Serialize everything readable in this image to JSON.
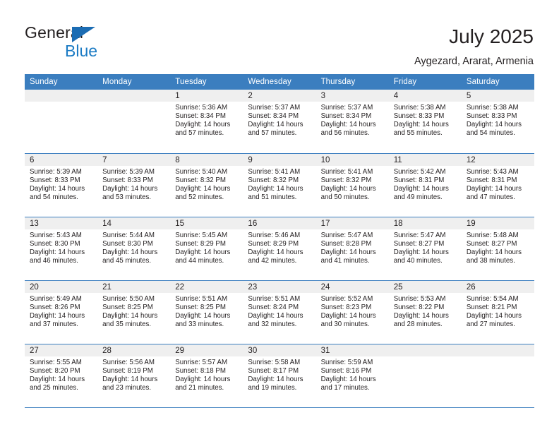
{
  "brand": {
    "name_dark": "General",
    "name_blue": "Blue",
    "triangle_icon": "triangle-icon",
    "accent_blue": "#1b7bc4",
    "header_blue": "#3b7ebf"
  },
  "header": {
    "title": "July 2025",
    "subtitle": "Aygezard, Ararat, Armenia"
  },
  "calendar": {
    "weekday_headers": [
      "Sunday",
      "Monday",
      "Tuesday",
      "Wednesday",
      "Thursday",
      "Friday",
      "Saturday"
    ],
    "labels": {
      "sunrise": "Sunrise:",
      "sunset": "Sunset:",
      "daylight": "Daylight:"
    },
    "weeks": [
      [
        {
          "day": "",
          "sunrise": "",
          "sunset": "",
          "daylight_line1": "",
          "daylight_line2": ""
        },
        {
          "day": "",
          "sunrise": "",
          "sunset": "",
          "daylight_line1": "",
          "daylight_line2": ""
        },
        {
          "day": "1",
          "sunrise": "Sunrise: 5:36 AM",
          "sunset": "Sunset: 8:34 PM",
          "daylight_line1": "Daylight: 14 hours",
          "daylight_line2": "and 57 minutes."
        },
        {
          "day": "2",
          "sunrise": "Sunrise: 5:37 AM",
          "sunset": "Sunset: 8:34 PM",
          "daylight_line1": "Daylight: 14 hours",
          "daylight_line2": "and 57 minutes."
        },
        {
          "day": "3",
          "sunrise": "Sunrise: 5:37 AM",
          "sunset": "Sunset: 8:34 PM",
          "daylight_line1": "Daylight: 14 hours",
          "daylight_line2": "and 56 minutes."
        },
        {
          "day": "4",
          "sunrise": "Sunrise: 5:38 AM",
          "sunset": "Sunset: 8:33 PM",
          "daylight_line1": "Daylight: 14 hours",
          "daylight_line2": "and 55 minutes."
        },
        {
          "day": "5",
          "sunrise": "Sunrise: 5:38 AM",
          "sunset": "Sunset: 8:33 PM",
          "daylight_line1": "Daylight: 14 hours",
          "daylight_line2": "and 54 minutes."
        }
      ],
      [
        {
          "day": "6",
          "sunrise": "Sunrise: 5:39 AM",
          "sunset": "Sunset: 8:33 PM",
          "daylight_line1": "Daylight: 14 hours",
          "daylight_line2": "and 54 minutes."
        },
        {
          "day": "7",
          "sunrise": "Sunrise: 5:39 AM",
          "sunset": "Sunset: 8:33 PM",
          "daylight_line1": "Daylight: 14 hours",
          "daylight_line2": "and 53 minutes."
        },
        {
          "day": "8",
          "sunrise": "Sunrise: 5:40 AM",
          "sunset": "Sunset: 8:32 PM",
          "daylight_line1": "Daylight: 14 hours",
          "daylight_line2": "and 52 minutes."
        },
        {
          "day": "9",
          "sunrise": "Sunrise: 5:41 AM",
          "sunset": "Sunset: 8:32 PM",
          "daylight_line1": "Daylight: 14 hours",
          "daylight_line2": "and 51 minutes."
        },
        {
          "day": "10",
          "sunrise": "Sunrise: 5:41 AM",
          "sunset": "Sunset: 8:32 PM",
          "daylight_line1": "Daylight: 14 hours",
          "daylight_line2": "and 50 minutes."
        },
        {
          "day": "11",
          "sunrise": "Sunrise: 5:42 AM",
          "sunset": "Sunset: 8:31 PM",
          "daylight_line1": "Daylight: 14 hours",
          "daylight_line2": "and 49 minutes."
        },
        {
          "day": "12",
          "sunrise": "Sunrise: 5:43 AM",
          "sunset": "Sunset: 8:31 PM",
          "daylight_line1": "Daylight: 14 hours",
          "daylight_line2": "and 47 minutes."
        }
      ],
      [
        {
          "day": "13",
          "sunrise": "Sunrise: 5:43 AM",
          "sunset": "Sunset: 8:30 PM",
          "daylight_line1": "Daylight: 14 hours",
          "daylight_line2": "and 46 minutes."
        },
        {
          "day": "14",
          "sunrise": "Sunrise: 5:44 AM",
          "sunset": "Sunset: 8:30 PM",
          "daylight_line1": "Daylight: 14 hours",
          "daylight_line2": "and 45 minutes."
        },
        {
          "day": "15",
          "sunrise": "Sunrise: 5:45 AM",
          "sunset": "Sunset: 8:29 PM",
          "daylight_line1": "Daylight: 14 hours",
          "daylight_line2": "and 44 minutes."
        },
        {
          "day": "16",
          "sunrise": "Sunrise: 5:46 AM",
          "sunset": "Sunset: 8:29 PM",
          "daylight_line1": "Daylight: 14 hours",
          "daylight_line2": "and 42 minutes."
        },
        {
          "day": "17",
          "sunrise": "Sunrise: 5:47 AM",
          "sunset": "Sunset: 8:28 PM",
          "daylight_line1": "Daylight: 14 hours",
          "daylight_line2": "and 41 minutes."
        },
        {
          "day": "18",
          "sunrise": "Sunrise: 5:47 AM",
          "sunset": "Sunset: 8:27 PM",
          "daylight_line1": "Daylight: 14 hours",
          "daylight_line2": "and 40 minutes."
        },
        {
          "day": "19",
          "sunrise": "Sunrise: 5:48 AM",
          "sunset": "Sunset: 8:27 PM",
          "daylight_line1": "Daylight: 14 hours",
          "daylight_line2": "and 38 minutes."
        }
      ],
      [
        {
          "day": "20",
          "sunrise": "Sunrise: 5:49 AM",
          "sunset": "Sunset: 8:26 PM",
          "daylight_line1": "Daylight: 14 hours",
          "daylight_line2": "and 37 minutes."
        },
        {
          "day": "21",
          "sunrise": "Sunrise: 5:50 AM",
          "sunset": "Sunset: 8:25 PM",
          "daylight_line1": "Daylight: 14 hours",
          "daylight_line2": "and 35 minutes."
        },
        {
          "day": "22",
          "sunrise": "Sunrise: 5:51 AM",
          "sunset": "Sunset: 8:25 PM",
          "daylight_line1": "Daylight: 14 hours",
          "daylight_line2": "and 33 minutes."
        },
        {
          "day": "23",
          "sunrise": "Sunrise: 5:51 AM",
          "sunset": "Sunset: 8:24 PM",
          "daylight_line1": "Daylight: 14 hours",
          "daylight_line2": "and 32 minutes."
        },
        {
          "day": "24",
          "sunrise": "Sunrise: 5:52 AM",
          "sunset": "Sunset: 8:23 PM",
          "daylight_line1": "Daylight: 14 hours",
          "daylight_line2": "and 30 minutes."
        },
        {
          "day": "25",
          "sunrise": "Sunrise: 5:53 AM",
          "sunset": "Sunset: 8:22 PM",
          "daylight_line1": "Daylight: 14 hours",
          "daylight_line2": "and 28 minutes."
        },
        {
          "day": "26",
          "sunrise": "Sunrise: 5:54 AM",
          "sunset": "Sunset: 8:21 PM",
          "daylight_line1": "Daylight: 14 hours",
          "daylight_line2": "and 27 minutes."
        }
      ],
      [
        {
          "day": "27",
          "sunrise": "Sunrise: 5:55 AM",
          "sunset": "Sunset: 8:20 PM",
          "daylight_line1": "Daylight: 14 hours",
          "daylight_line2": "and 25 minutes."
        },
        {
          "day": "28",
          "sunrise": "Sunrise: 5:56 AM",
          "sunset": "Sunset: 8:19 PM",
          "daylight_line1": "Daylight: 14 hours",
          "daylight_line2": "and 23 minutes."
        },
        {
          "day": "29",
          "sunrise": "Sunrise: 5:57 AM",
          "sunset": "Sunset: 8:18 PM",
          "daylight_line1": "Daylight: 14 hours",
          "daylight_line2": "and 21 minutes."
        },
        {
          "day": "30",
          "sunrise": "Sunrise: 5:58 AM",
          "sunset": "Sunset: 8:17 PM",
          "daylight_line1": "Daylight: 14 hours",
          "daylight_line2": "and 19 minutes."
        },
        {
          "day": "31",
          "sunrise": "Sunrise: 5:59 AM",
          "sunset": "Sunset: 8:16 PM",
          "daylight_line1": "Daylight: 14 hours",
          "daylight_line2": "and 17 minutes."
        },
        {
          "day": "",
          "sunrise": "",
          "sunset": "",
          "daylight_line1": "",
          "daylight_line2": ""
        },
        {
          "day": "",
          "sunrise": "",
          "sunset": "",
          "daylight_line1": "",
          "daylight_line2": ""
        }
      ]
    ]
  }
}
